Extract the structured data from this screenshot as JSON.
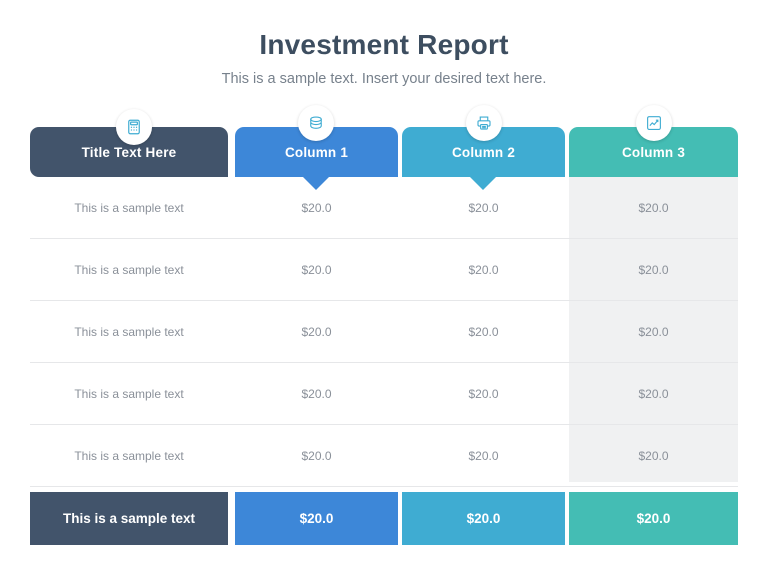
{
  "title": "Investment Report",
  "subtitle": "This is a sample text. Insert your desired text here.",
  "colors": {
    "title": "#3d4e60",
    "subtitle": "#77818c",
    "col0": "#42546b",
    "col1": "#3d87d8",
    "col2": "#3facd2",
    "col3": "#44bdb4",
    "zebra": "#f0f1f2",
    "body_text": "#8a9099"
  },
  "table": {
    "headers": [
      {
        "label": "Title Text Here",
        "icon": "calculator-icon"
      },
      {
        "label": "Column 1",
        "icon": "coins-stack-icon"
      },
      {
        "label": "Column 2",
        "icon": "printer-icon"
      },
      {
        "label": "Column 3",
        "icon": "line-chart-icon"
      }
    ],
    "rows": [
      [
        "This is a sample text",
        "$20.0",
        "$20.0",
        "$20.0"
      ],
      [
        "This is a sample text",
        "$20.0",
        "$20.0",
        "$20.0"
      ],
      [
        "This is a sample text",
        "$20.0",
        "$20.0",
        "$20.0"
      ],
      [
        "This is a sample text",
        "$20.0",
        "$20.0",
        "$20.0"
      ],
      [
        "This is a sample text",
        "$20.0",
        "$20.0",
        "$20.0"
      ]
    ],
    "total_row": [
      "This is a sample text",
      "$20.0",
      "$20.0",
      "$20.0"
    ]
  }
}
